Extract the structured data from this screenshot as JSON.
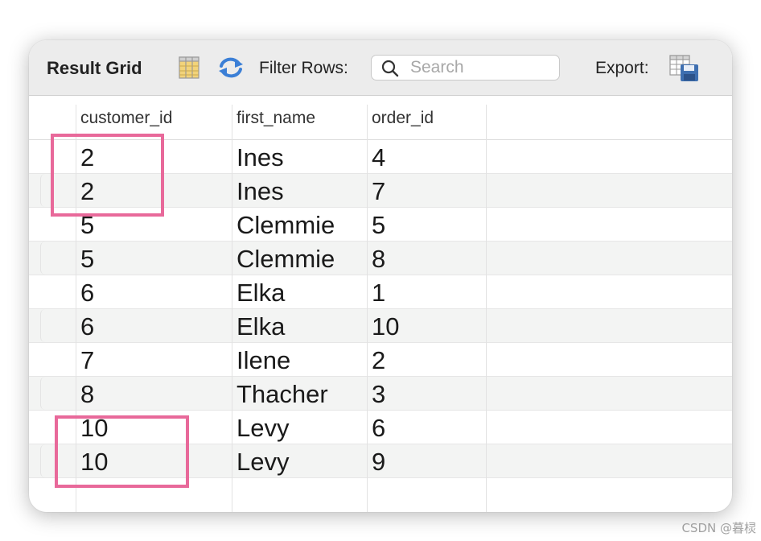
{
  "toolbar": {
    "title": "Result Grid",
    "filter_label": "Filter Rows:",
    "search_placeholder": "Search",
    "search_value": "",
    "export_label": "Export:"
  },
  "columns": [
    "customer_id",
    "first_name",
    "order_id"
  ],
  "rows": [
    {
      "customer_id": "2",
      "first_name": "Ines",
      "order_id": "4"
    },
    {
      "customer_id": "2",
      "first_name": "Ines",
      "order_id": "7"
    },
    {
      "customer_id": "5",
      "first_name": "Clemmie",
      "order_id": "5"
    },
    {
      "customer_id": "5",
      "first_name": "Clemmie",
      "order_id": "8"
    },
    {
      "customer_id": "6",
      "first_name": "Elka",
      "order_id": "1"
    },
    {
      "customer_id": "6",
      "first_name": "Elka",
      "order_id": "10"
    },
    {
      "customer_id": "7",
      "first_name": "Ilene",
      "order_id": "2"
    },
    {
      "customer_id": "8",
      "first_name": "Thacher",
      "order_id": "3"
    },
    {
      "customer_id": "10",
      "first_name": "Levy",
      "order_id": "6"
    },
    {
      "customer_id": "10",
      "first_name": "Levy",
      "order_id": "9"
    }
  ],
  "highlight_color": "#e8699a",
  "icons": {
    "grid": "grid-layout-icon",
    "refresh": "refresh-icon",
    "search": "search-icon",
    "export": "export-icon"
  },
  "watermark": "CSDN @暮棂"
}
